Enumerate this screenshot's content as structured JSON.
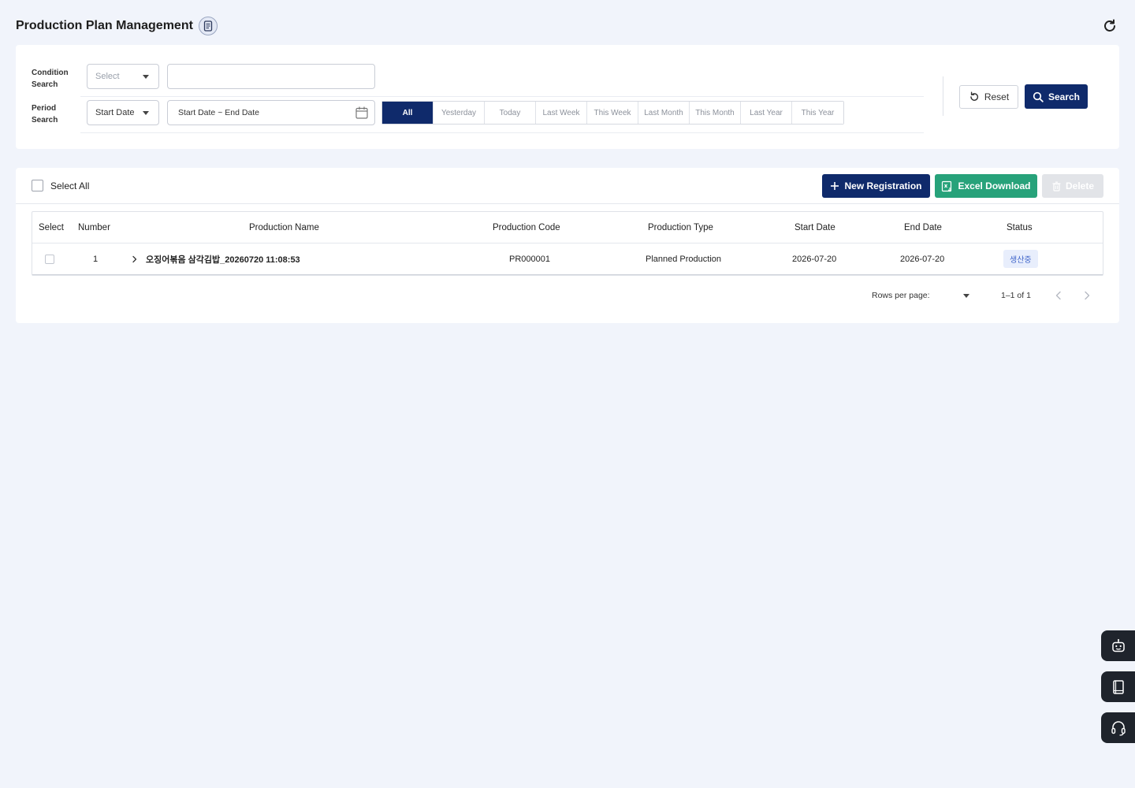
{
  "header": {
    "title": "Production Plan Management",
    "doc_icon": "document-icon",
    "refresh_icon": "refresh-icon"
  },
  "search": {
    "condition_label_1": "Condition",
    "condition_label_2": "Search",
    "condition_select_placeholder": "Select",
    "condition_input_value": "",
    "period_label_1": "Period",
    "period_label_2": "Search",
    "period_select_value": "Start Date",
    "date_range_placeholder": "Start Date ~ End Date",
    "periods": [
      "All",
      "Yesterday",
      "Today",
      "Last Week",
      "This Week",
      "Last Month",
      "This Month",
      "Last Year",
      "This Year"
    ],
    "active_period": "All",
    "reset_label": "Reset",
    "search_label": "Search"
  },
  "toolbar": {
    "select_all_label": "Select All",
    "new_label": "New Registration",
    "excel_label": "Excel Download",
    "delete_label": "Delete"
  },
  "table": {
    "columns": [
      "Select",
      "Number",
      "Production Name",
      "Production Code",
      "Production Type",
      "Start Date",
      "End Date",
      "Status"
    ],
    "rows": [
      {
        "number": "1",
        "name": "오징어볶음 삼각김밥_20260720 11:08:53",
        "code": "PR000001",
        "type": "Planned Production",
        "start": "2026-07-20",
        "end": "2026-07-20",
        "status": "생산중"
      }
    ]
  },
  "pagination": {
    "rows_per_page_label": "Rows per page:",
    "rows_per_page_value": "",
    "page_info": "1–1 of 1"
  },
  "colors": {
    "primary": "#0f2a6b",
    "excel": "#27a27a",
    "disabled": "#e2e4e8",
    "background": "#f1f4fb"
  }
}
